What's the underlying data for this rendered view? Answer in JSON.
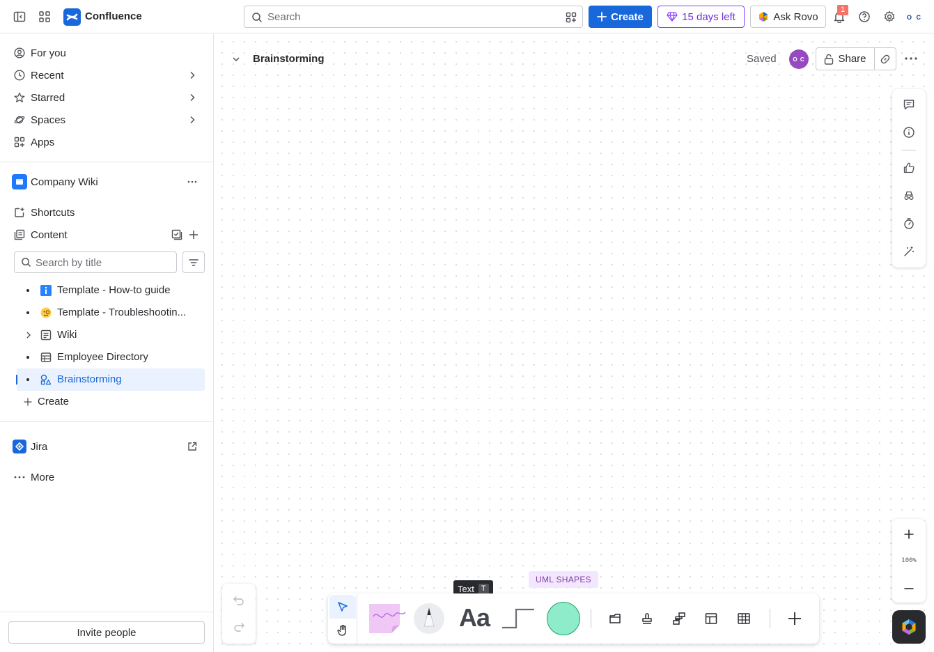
{
  "topbar": {
    "app_name": "Confluence",
    "search_placeholder": "Search",
    "create_label": "Create",
    "trial_label": "15 days left",
    "rovo_label": "Ask Rovo",
    "notification_count": "1",
    "avatar_initials": "O C"
  },
  "sidebar": {
    "nav": [
      {
        "label": "For you"
      },
      {
        "label": "Recent"
      },
      {
        "label": "Starred"
      },
      {
        "label": "Spaces"
      },
      {
        "label": "Apps"
      }
    ],
    "space_name": "Company Wiki",
    "shortcuts_label": "Shortcuts",
    "content_label": "Content",
    "search_placeholder": "Search by title",
    "tree": [
      {
        "label": "Template - How-to guide"
      },
      {
        "label": "Template - Troubleshootin..."
      },
      {
        "label": "Wiki"
      },
      {
        "label": "Employee Directory"
      },
      {
        "label": "Brainstorming"
      }
    ],
    "create_label": "Create",
    "jira_label": "Jira",
    "more_label": "More",
    "invite_label": "Invite people"
  },
  "page": {
    "title": "Brainstorming",
    "status": "Saved",
    "avatar_initials": "O C",
    "share_label": "Share",
    "zoom_level": "100%"
  },
  "toolbar": {
    "tooltip_label": "Text",
    "tooltip_key": "T",
    "uml_label": "UML SHAPES",
    "text_tool_glyph": "Aa"
  },
  "colors": {
    "accent": "#1868db",
    "trial": "#8a3ffc",
    "shape_fill": "#8eeccb",
    "sticky_fill": "#f0c8f5"
  }
}
